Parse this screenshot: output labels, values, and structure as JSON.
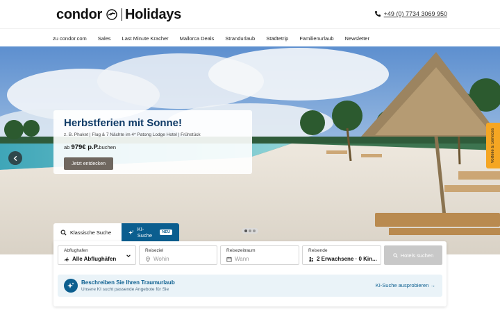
{
  "header": {
    "brand": "condor",
    "brand_sub": "Holidays",
    "phone": "+49 (0) 7734 3069 950"
  },
  "nav": {
    "items": [
      "zu condor.com",
      "Sales",
      "Last Minute Kracher",
      "Mallorca Deals",
      "Strandurlaub",
      "Städtetrip",
      "Familienurlaub",
      "Newsletter"
    ]
  },
  "hero": {
    "title": "Herbstferien mit Sonne!",
    "subtitle": "z. B. Phuket | Flug & 7 Nächte im 4* Patong Lodge Hotel | Frühstück",
    "price_prefix": "ab",
    "price": "979€ p.P.",
    "price_suffix": "buchen",
    "cta": "Jetzt entdecken",
    "side_tab": "Vorteile & Services",
    "slides_active": 1,
    "slides_total": 3
  },
  "search": {
    "tabs": [
      {
        "label": "Klassische Suche",
        "icon": "search-icon"
      },
      {
        "label": "KI-Suche",
        "icon": "sparkle-icon",
        "badge": "NEU"
      }
    ],
    "fields": {
      "departure": {
        "label": "Abflughafen",
        "value": "Alle Abflughäfen"
      },
      "destination": {
        "label": "Reiseziel",
        "placeholder": "Wohin"
      },
      "dates": {
        "label": "Reisezeitraum",
        "placeholder": "Wann"
      },
      "travelers": {
        "label": "Reisende",
        "value": "2 Erwachsene · 0 Kin..."
      }
    },
    "button": "Hotels suchen"
  },
  "ki_banner": {
    "title": "Beschreiben Sie Ihren Traumurlaub",
    "subtitle": "Unsere KI sucht passende Angebote für Sie",
    "link": "KI-Suche ausprobieren →"
  },
  "colors": {
    "accent": "#0b5e8f",
    "promo_title": "#0e3a66",
    "side_tab": "#f5a623",
    "cta": "#6f675f"
  }
}
